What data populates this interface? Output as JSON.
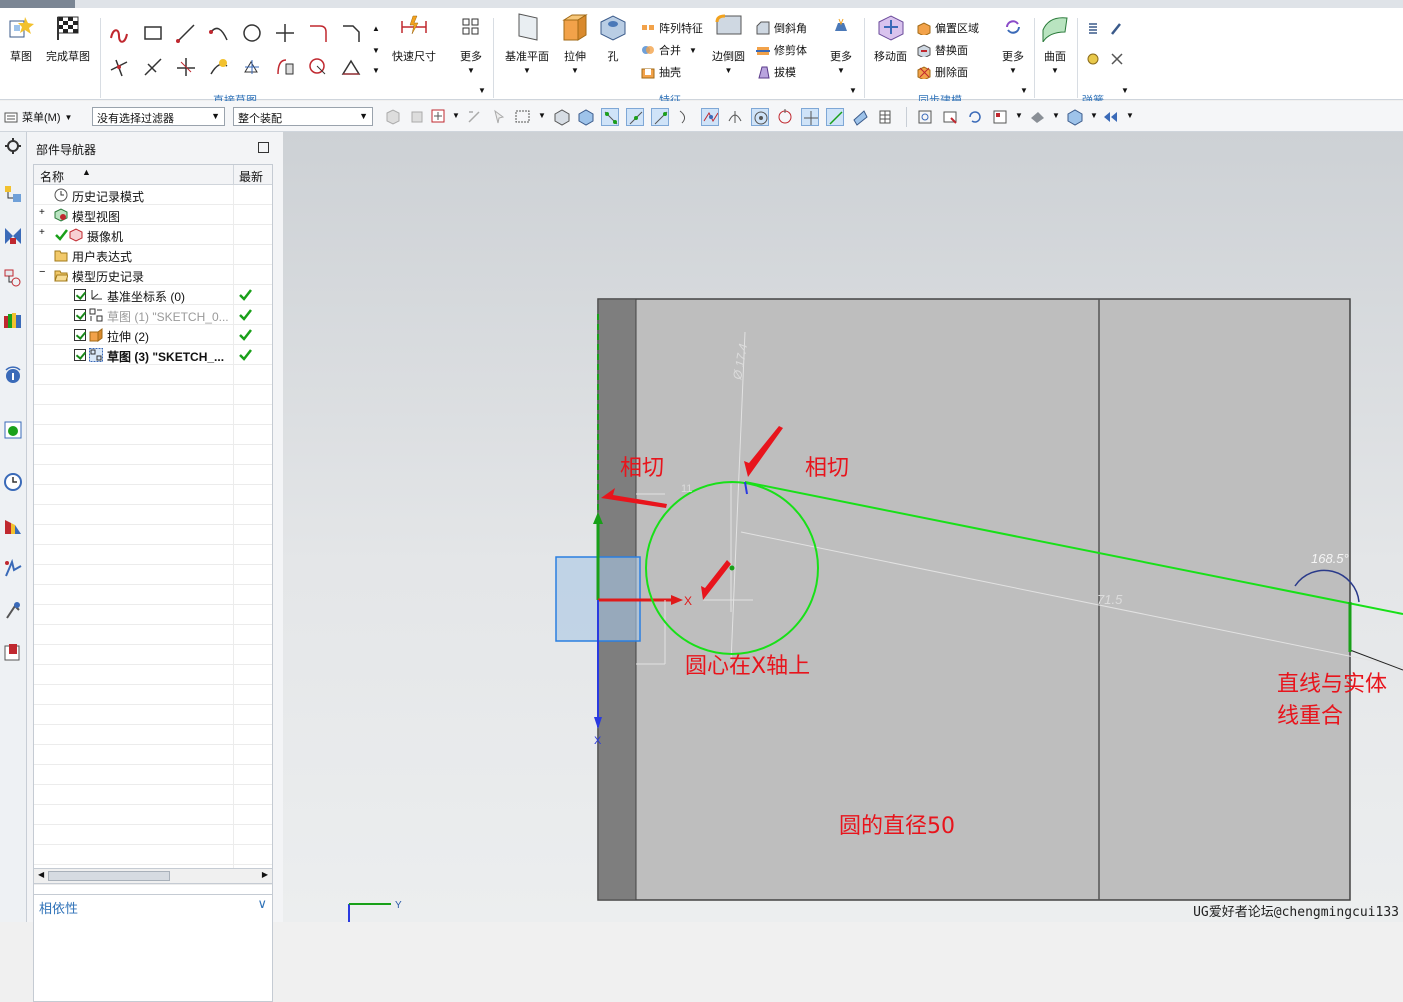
{
  "ribbon": {
    "sketch": "草图",
    "finish_sketch": "完成草图",
    "quick_dim": "快速尺寸",
    "more1": "更多",
    "group_direct_sketch": "直接草图",
    "datum_plane": "基准平面",
    "extrude": "拉伸",
    "hole": "孔",
    "pattern_feature": "阵列特征",
    "unite": "合并",
    "shell": "抽壳",
    "edge_blend": "边倒圆",
    "chamfer": "倒斜角",
    "trim_body": "修剪体",
    "draft": "拔模",
    "more2": "更多",
    "group_feature": "特征",
    "move_face": "移动面",
    "offset_region": "偏置区域",
    "replace_face": "替换面",
    "delete_face": "删除面",
    "more3": "更多",
    "group_sync": "同步建模",
    "surface": "曲面",
    "group_spring": "弹簧..."
  },
  "toolbar2": {
    "menu": "菜单(M)",
    "filter": "没有选择过滤器",
    "assembly": "整个装配"
  },
  "navigator": {
    "title": "部件导航器",
    "col_name": "名称",
    "col_latest": "最新",
    "rows": [
      {
        "label": "历史记录模式",
        "checked": false,
        "ok": false
      },
      {
        "label": "模型视图",
        "checked": false,
        "ok": false
      },
      {
        "label": "摄像机",
        "checked": false,
        "ok": false
      },
      {
        "label": "用户表达式",
        "checked": false,
        "ok": false
      },
      {
        "label": "模型历史记录",
        "checked": false,
        "ok": false
      },
      {
        "label": "基准坐标系 (0)",
        "checked": true,
        "ok": true
      },
      {
        "label": "草图 (1) \"SKETCH_0...",
        "checked": true,
        "ok": true
      },
      {
        "label": "拉伸 (2)",
        "checked": true,
        "ok": true
      },
      {
        "label": "草图 (3) \"SKETCH_...",
        "checked": true,
        "ok": true
      }
    ],
    "dependency": "相依性"
  },
  "viewport": {
    "annotations": {
      "tangent_left": "相切",
      "tangent_right": "相切",
      "center_on_x": "圆心在X轴上",
      "line_overlap_1": "直线与实体",
      "line_overlap_2": "线重合",
      "diameter": "圆的直径50"
    },
    "dims": {
      "d_angle": "168.5°",
      "d_dia": "Ø 17.4",
      "d_len": "71.5",
      "d_small": "11"
    },
    "axis_x": "X",
    "axis_y": "Y",
    "watermark": "UG爱好者论坛@chengmingcui133"
  },
  "colors": {
    "sketch_green": "#18e018",
    "annotation_red": "#e8141c",
    "accent_blue": "#2f72b8"
  }
}
